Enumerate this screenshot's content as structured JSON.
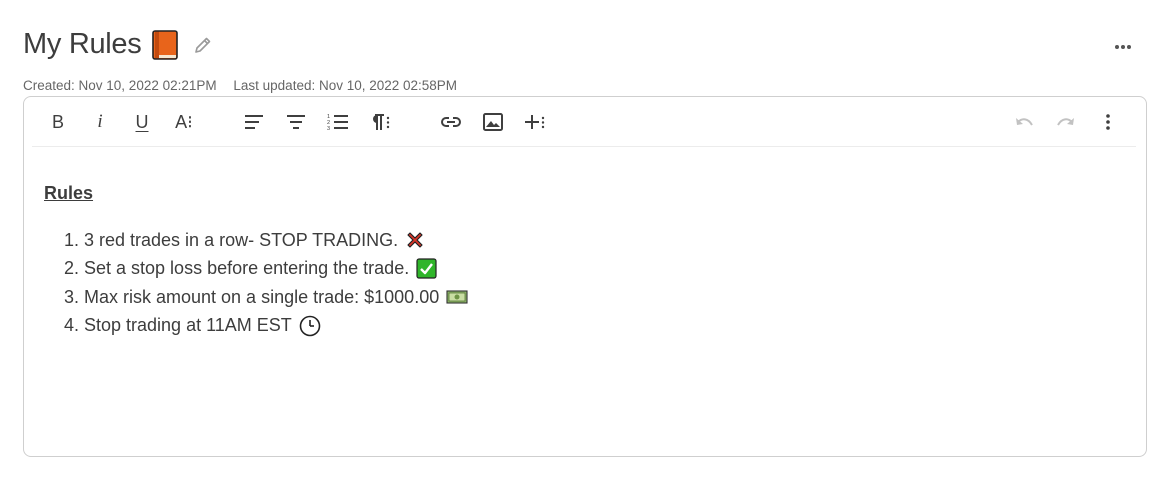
{
  "header": {
    "title": "My Rules",
    "title_icon": "orange-book-icon",
    "edit_icon": "pencil-icon",
    "more_icon": "more-horizontal-icon",
    "created": "Created: Nov 10, 2022 02:21PM",
    "updated": "Last updated: Nov 10, 2022 02:58PM"
  },
  "toolbar": {
    "bold": "B",
    "italic": "i",
    "underline": "U",
    "font_size": "A⁝",
    "align_left_icon": "align-left-icon",
    "align_center_icon": "align-center-icon",
    "ordered_list_icon": "ordered-list-icon",
    "paragraph_icon": "paragraph-icon",
    "link_icon": "link-icon",
    "image_icon": "image-icon",
    "insert_more_icon": "insert-more-icon",
    "undo_icon": "undo-icon",
    "redo_icon": "redo-icon",
    "more_vertical_icon": "more-vertical-icon"
  },
  "document": {
    "heading": "Rules",
    "items": [
      {
        "num": "1.",
        "text": "3 red trades in a row- STOP TRADING.",
        "emoji": "cross-mark-icon"
      },
      {
        "num": "2.",
        "text": "Set a stop loss before entering the trade.",
        "emoji": "check-box-icon"
      },
      {
        "num": "3.",
        "text": "Max risk amount on a single trade: $1000.00",
        "emoji": "dollar-bill-icon"
      },
      {
        "num": "4.",
        "text": "Stop trading at 11AM EST",
        "emoji": "clock-icon"
      }
    ]
  },
  "colors": {
    "book": "#e8641b",
    "cross": "#d9352a",
    "check_bg": "#2fb52a",
    "bill": "#8fb56a",
    "border": "#cfcfcf",
    "icon": "#3f3f3f",
    "disabled_icon": "#c2c2c2"
  }
}
